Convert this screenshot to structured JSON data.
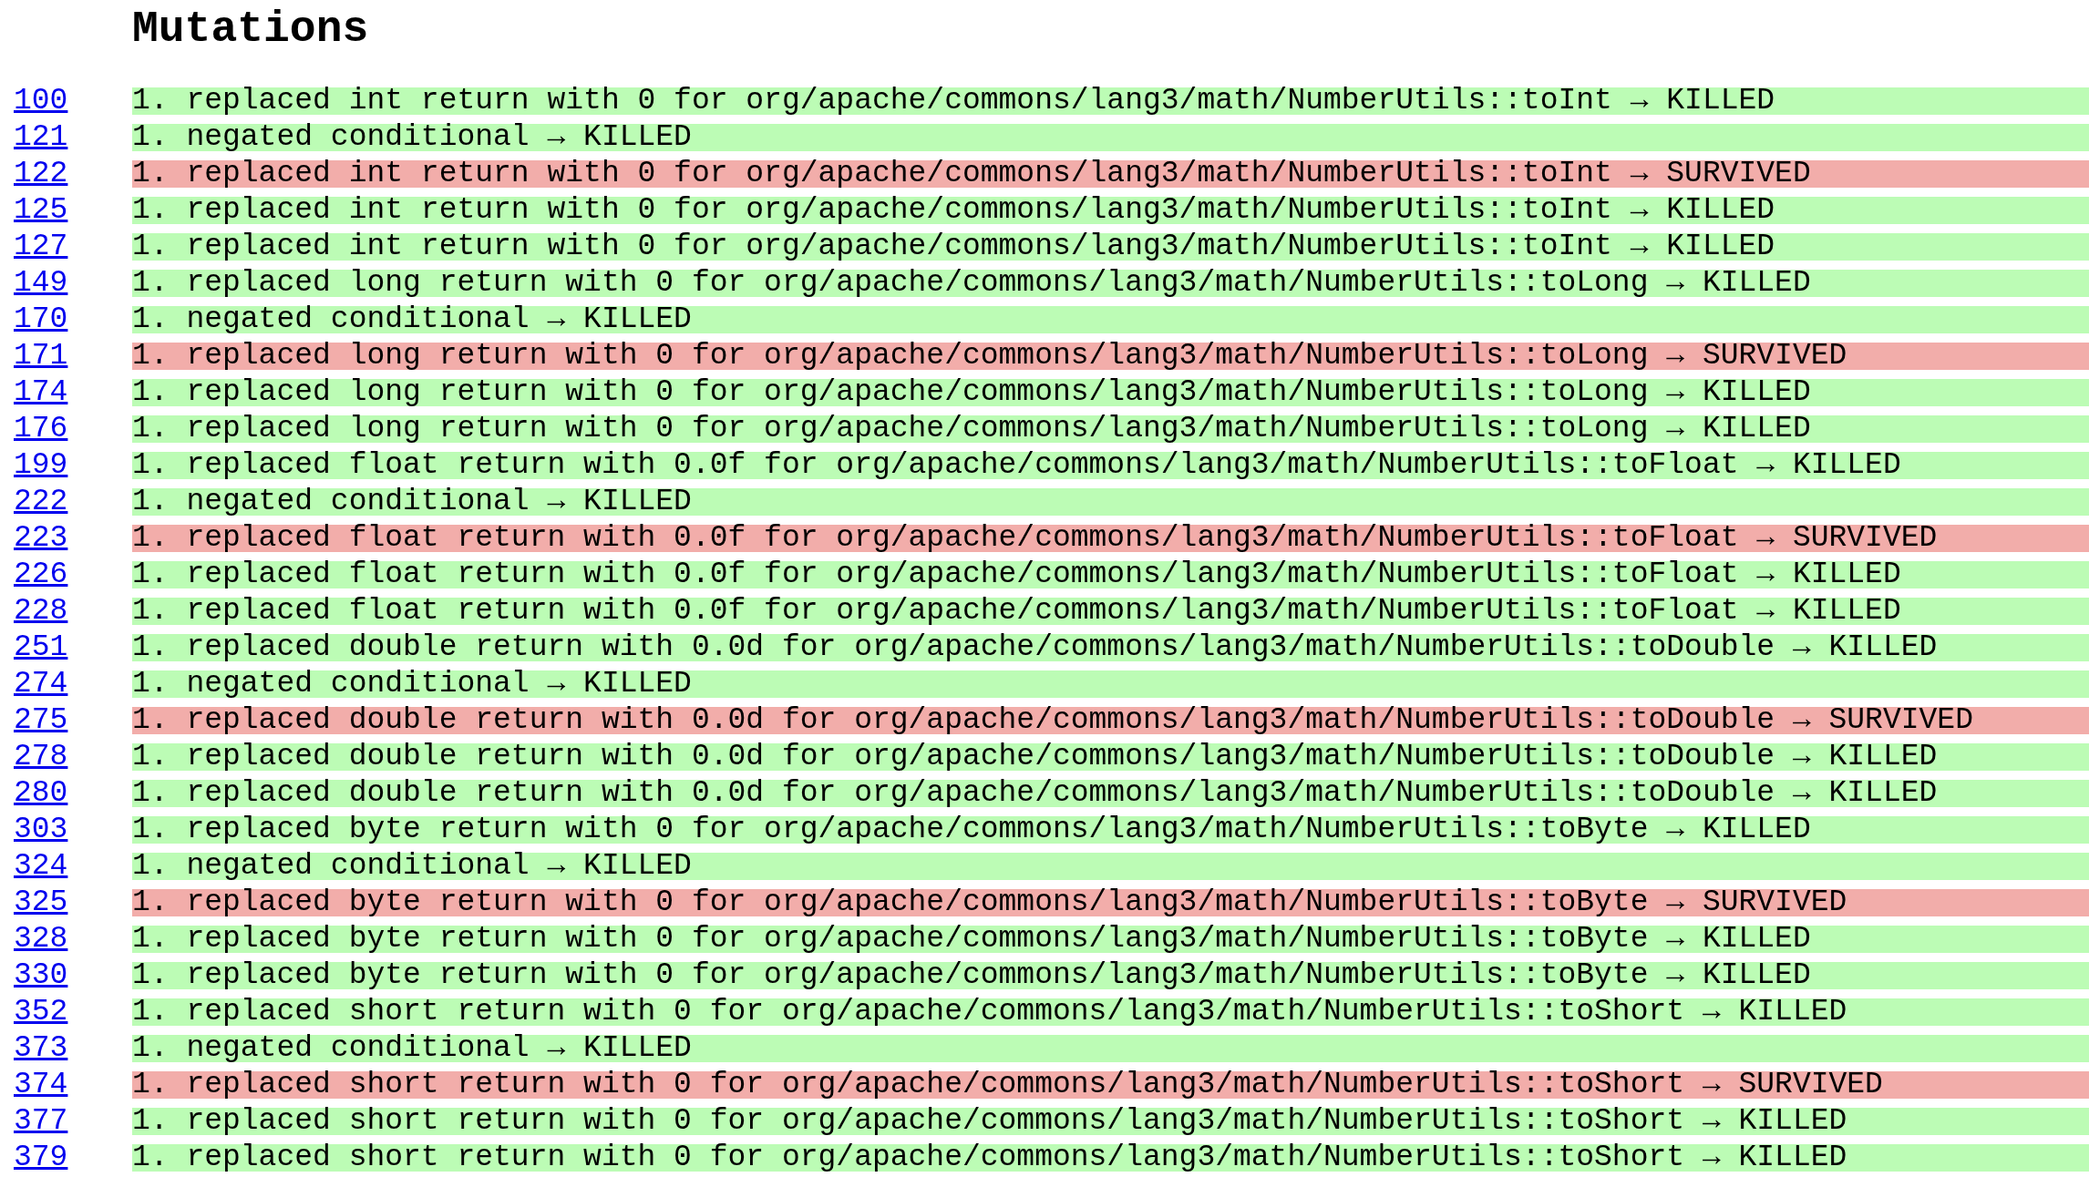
{
  "title": "Mutations",
  "rows": [
    {
      "line": "100",
      "text": "1. replaced int return with 0 for org/apache/commons/lang3/math/NumberUtils::toInt → KILLED",
      "survived": false
    },
    {
      "line": "121",
      "text": "1. negated conditional → KILLED",
      "survived": false
    },
    {
      "line": "122",
      "text": "1. replaced int return with 0 for org/apache/commons/lang3/math/NumberUtils::toInt → SURVIVED",
      "survived": true
    },
    {
      "line": "125",
      "text": "1. replaced int return with 0 for org/apache/commons/lang3/math/NumberUtils::toInt → KILLED",
      "survived": false
    },
    {
      "line": "127",
      "text": "1. replaced int return with 0 for org/apache/commons/lang3/math/NumberUtils::toInt → KILLED",
      "survived": false
    },
    {
      "line": "149",
      "text": "1. replaced long return with 0 for org/apache/commons/lang3/math/NumberUtils::toLong → KILLED",
      "survived": false
    },
    {
      "line": "170",
      "text": "1. negated conditional → KILLED",
      "survived": false
    },
    {
      "line": "171",
      "text": "1. replaced long return with 0 for org/apache/commons/lang3/math/NumberUtils::toLong → SURVIVED",
      "survived": true
    },
    {
      "line": "174",
      "text": "1. replaced long return with 0 for org/apache/commons/lang3/math/NumberUtils::toLong → KILLED",
      "survived": false
    },
    {
      "line": "176",
      "text": "1. replaced long return with 0 for org/apache/commons/lang3/math/NumberUtils::toLong → KILLED",
      "survived": false
    },
    {
      "line": "199",
      "text": "1. replaced float return with 0.0f for org/apache/commons/lang3/math/NumberUtils::toFloat → KILLED",
      "survived": false
    },
    {
      "line": "222",
      "text": "1. negated conditional → KILLED",
      "survived": false
    },
    {
      "line": "223",
      "text": "1. replaced float return with 0.0f for org/apache/commons/lang3/math/NumberUtils::toFloat → SURVIVED",
      "survived": true
    },
    {
      "line": "226",
      "text": "1. replaced float return with 0.0f for org/apache/commons/lang3/math/NumberUtils::toFloat → KILLED",
      "survived": false
    },
    {
      "line": "228",
      "text": "1. replaced float return with 0.0f for org/apache/commons/lang3/math/NumberUtils::toFloat → KILLED",
      "survived": false
    },
    {
      "line": "251",
      "text": "1. replaced double return with 0.0d for org/apache/commons/lang3/math/NumberUtils::toDouble → KILLED",
      "survived": false
    },
    {
      "line": "274",
      "text": "1. negated conditional → KILLED",
      "survived": false
    },
    {
      "line": "275",
      "text": "1. replaced double return with 0.0d for org/apache/commons/lang3/math/NumberUtils::toDouble → SURVIVED",
      "survived": true
    },
    {
      "line": "278",
      "text": "1. replaced double return with 0.0d for org/apache/commons/lang3/math/NumberUtils::toDouble → KILLED",
      "survived": false
    },
    {
      "line": "280",
      "text": "1. replaced double return with 0.0d for org/apache/commons/lang3/math/NumberUtils::toDouble → KILLED",
      "survived": false
    },
    {
      "line": "303",
      "text": "1. replaced byte return with 0 for org/apache/commons/lang3/math/NumberUtils::toByte → KILLED",
      "survived": false
    },
    {
      "line": "324",
      "text": "1. negated conditional → KILLED",
      "survived": false
    },
    {
      "line": "325",
      "text": "1. replaced byte return with 0 for org/apache/commons/lang3/math/NumberUtils::toByte → SURVIVED",
      "survived": true
    },
    {
      "line": "328",
      "text": "1. replaced byte return with 0 for org/apache/commons/lang3/math/NumberUtils::toByte → KILLED",
      "survived": false
    },
    {
      "line": "330",
      "text": "1. replaced byte return with 0 for org/apache/commons/lang3/math/NumberUtils::toByte → KILLED",
      "survived": false
    },
    {
      "line": "352",
      "text": "1. replaced short return with 0 for org/apache/commons/lang3/math/NumberUtils::toShort → KILLED",
      "survived": false
    },
    {
      "line": "373",
      "text": "1. negated conditional → KILLED",
      "survived": false
    },
    {
      "line": "374",
      "text": "1. replaced short return with 0 for org/apache/commons/lang3/math/NumberUtils::toShort → SURVIVED",
      "survived": true
    },
    {
      "line": "377",
      "text": "1. replaced short return with 0 for org/apache/commons/lang3/math/NumberUtils::toShort → KILLED",
      "survived": false
    },
    {
      "line": "379",
      "text": "1. replaced short return with 0 for org/apache/commons/lang3/math/NumberUtils::toShort → KILLED",
      "survived": false
    }
  ]
}
